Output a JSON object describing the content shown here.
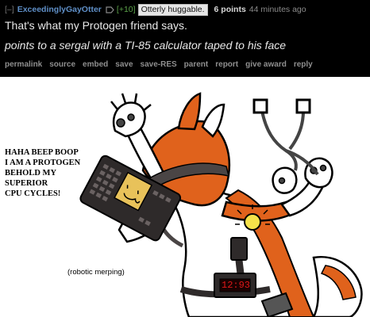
{
  "comment": {
    "collapse": "[–]",
    "username": "ExceedinglyGayOtter",
    "score_badge": "[+10]",
    "flair": "Otterly huggable.",
    "points": "6 points",
    "time": "44 minutes ago",
    "body_line1": "That's what my Protogen friend says.",
    "body_line2": "points to a sergal with a TI-85 calculator taped to his face",
    "actions": [
      "permalink",
      "source",
      "embed",
      "save",
      "save-RES",
      "parent",
      "report",
      "give award",
      "reply"
    ]
  },
  "drawing": {
    "speech_lines": [
      "HAHA BEEP BOOP",
      "I AM A PROTOGEN",
      "BEHOLD MY",
      "SUPERIOR",
      "CPU CYCLES!"
    ],
    "caption": "(robotic merping)",
    "watch_display": "12:93",
    "colors": {
      "fur_orange": "#e0621c",
      "fur_white": "#ffffff",
      "device_dark": "#2e2a2a",
      "calc_face": "#e8c25a",
      "watch_red": "#e01818",
      "bulb_yellow": "#f6e24a"
    }
  },
  "colors": {
    "background": "#000000",
    "username": "#5f8fc7",
    "score_badge": "#5ca24a",
    "action_text": "#8f8f8f"
  }
}
